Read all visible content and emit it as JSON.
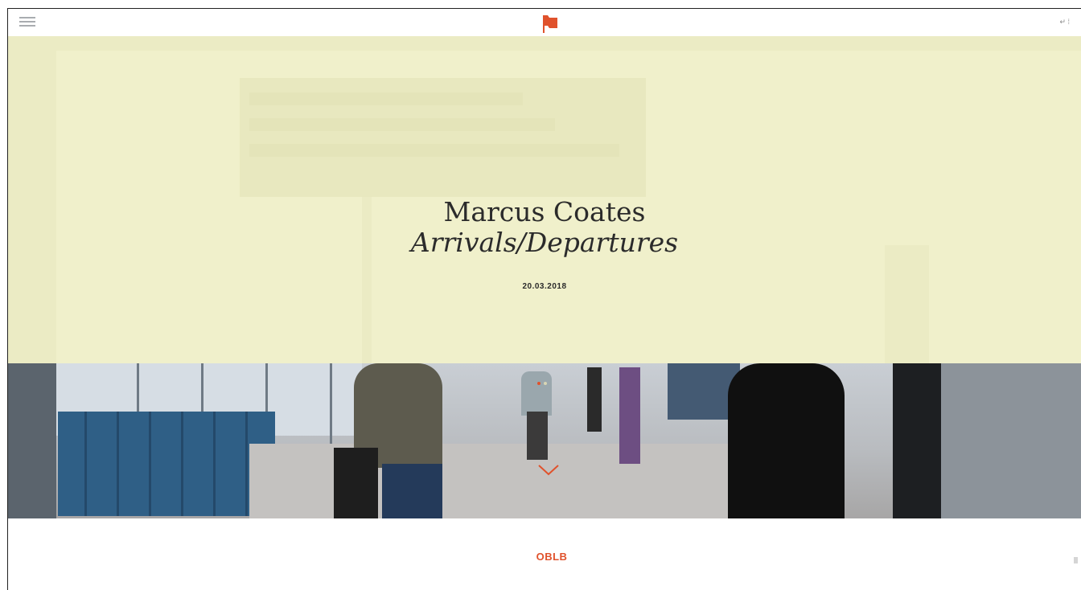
{
  "header": {
    "lang_toggle": "↵ ⁞"
  },
  "hero": {
    "artist": "Marcus Coates",
    "show_title": "Arrivals/Departures",
    "date": "20.03.2018",
    "slider": {
      "count": 2,
      "active_index": 0
    }
  },
  "footer": {
    "logo_text": "OBLB"
  },
  "colors": {
    "accent": "#e0522c",
    "hero_overlay": "#eeeec8",
    "text": "#2b2b2b"
  },
  "icons": {
    "menu": "menu-icon",
    "logo": "flag-logo-icon",
    "scroll": "chevron-down-icon"
  }
}
